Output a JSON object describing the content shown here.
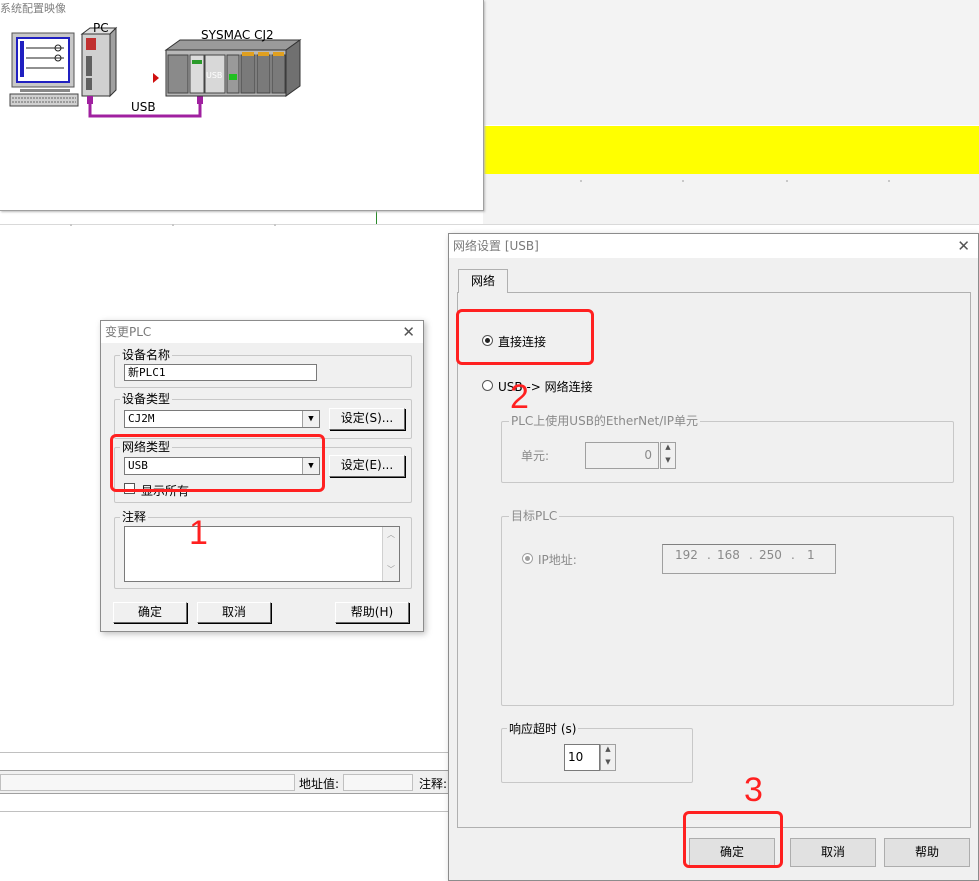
{
  "config_image": {
    "title": "系统配置映像",
    "pc_label": "PC",
    "plc_label": "SYSMAC CJ2",
    "usb_link_label": "USB",
    "usb_port_label": "USB"
  },
  "status_bar": {
    "address_label": "地址值:",
    "comment_label": "注释:"
  },
  "change_plc": {
    "title": "变更PLC",
    "device_name_label": "设备名称",
    "device_name_value": "新PLC1",
    "device_type_label": "设备类型",
    "device_type_value": "CJ2M",
    "device_type_settings": "设定(S)...",
    "network_type_label": "网络类型",
    "network_type_value": "USB",
    "network_settings": "设定(E)...",
    "show_all_label": "显示所有",
    "comment_label": "注释",
    "ok": "确定",
    "cancel": "取消",
    "help": "帮助(H)"
  },
  "network_settings": {
    "title": "网络设置 [USB]",
    "tab_network": "网络",
    "direct_connect": "直接连接",
    "usb_network": "USB -> 网络连接",
    "ethernet_unit_group": "PLC上使用USB的EtherNet/IP单元",
    "unit_label": "单元:",
    "unit_value": "0",
    "target_plc_group": "目标PLC",
    "ip_label": "IP地址:",
    "ip": [
      "192",
      "168",
      "250",
      "1"
    ],
    "timeout_group": "响应超时 (s)",
    "timeout_value": "10",
    "ok": "确定",
    "cancel": "取消",
    "help": "帮助"
  },
  "annotations": {
    "step1": "1",
    "step2": "2",
    "step3": "3"
  },
  "colors": {
    "highlight": "#ff2020",
    "yellow_band": "#ffff00",
    "usb_cable": "#a020a0"
  }
}
